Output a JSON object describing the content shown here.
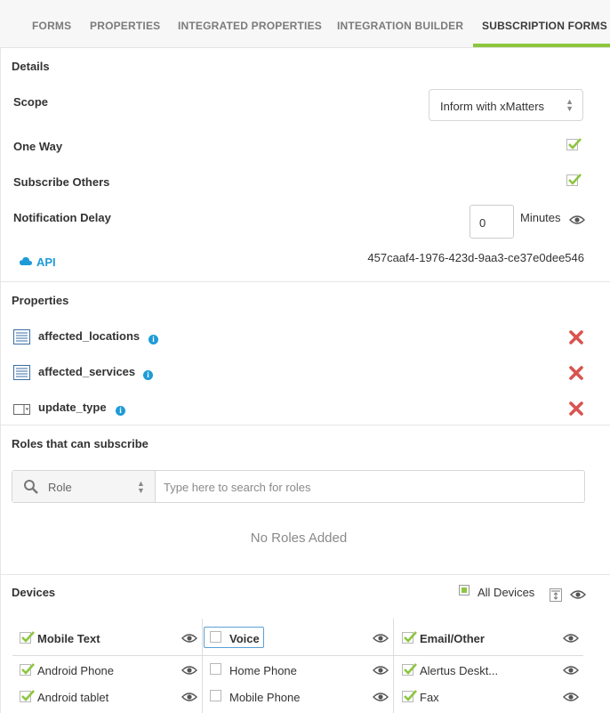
{
  "tabs": [
    "FORMS",
    "PROPERTIES",
    "INTEGRATED PROPERTIES",
    "INTEGRATION BUILDER",
    "SUBSCRIPTION FORMS"
  ],
  "active_tab": "SUBSCRIPTION FORMS",
  "details": {
    "title": "Details",
    "scope_label": "Scope",
    "scope_value": "Inform with xMatters",
    "one_way_label": "One Way",
    "one_way_checked": true,
    "subscribe_others_label": "Subscribe Others",
    "subscribe_others_checked": true,
    "notification_delay_label": "Notification Delay",
    "notification_delay_value": "0",
    "notification_delay_unit": "Minutes",
    "api_label": "API",
    "api_key": "457caaf4-1976-423d-9aa3-ce37e0dee546"
  },
  "properties": {
    "title": "Properties",
    "items": [
      {
        "name": "affected_locations",
        "icon": "list-property-icon"
      },
      {
        "name": "affected_services",
        "icon": "list-property-icon"
      },
      {
        "name": "update_type",
        "icon": "dropdown-property-icon"
      }
    ]
  },
  "roles": {
    "title": "Roles that can subscribe",
    "role_select": "Role",
    "search_placeholder": "Type here to search for roles",
    "empty_text": "No Roles Added"
  },
  "devices": {
    "title": "Devices",
    "all_devices_label": "All Devices",
    "columns": [
      {
        "header": "Mobile Text",
        "checked": true,
        "items": [
          {
            "label": "Android Phone",
            "checked": true
          },
          {
            "label": "Android tablet",
            "checked": true
          }
        ]
      },
      {
        "header": "Voice",
        "checked": false,
        "items": [
          {
            "label": "Home Phone",
            "checked": false
          },
          {
            "label": "Mobile Phone",
            "checked": false
          }
        ]
      },
      {
        "header": "Email/Other",
        "checked": true,
        "items": [
          {
            "label": "Alertus Deskt...",
            "checked": true
          },
          {
            "label": "Fax",
            "checked": true
          }
        ]
      }
    ]
  },
  "colors": {
    "accent": "#8cc63f",
    "link": "#1e9bd7",
    "delete": "#d9534f"
  }
}
